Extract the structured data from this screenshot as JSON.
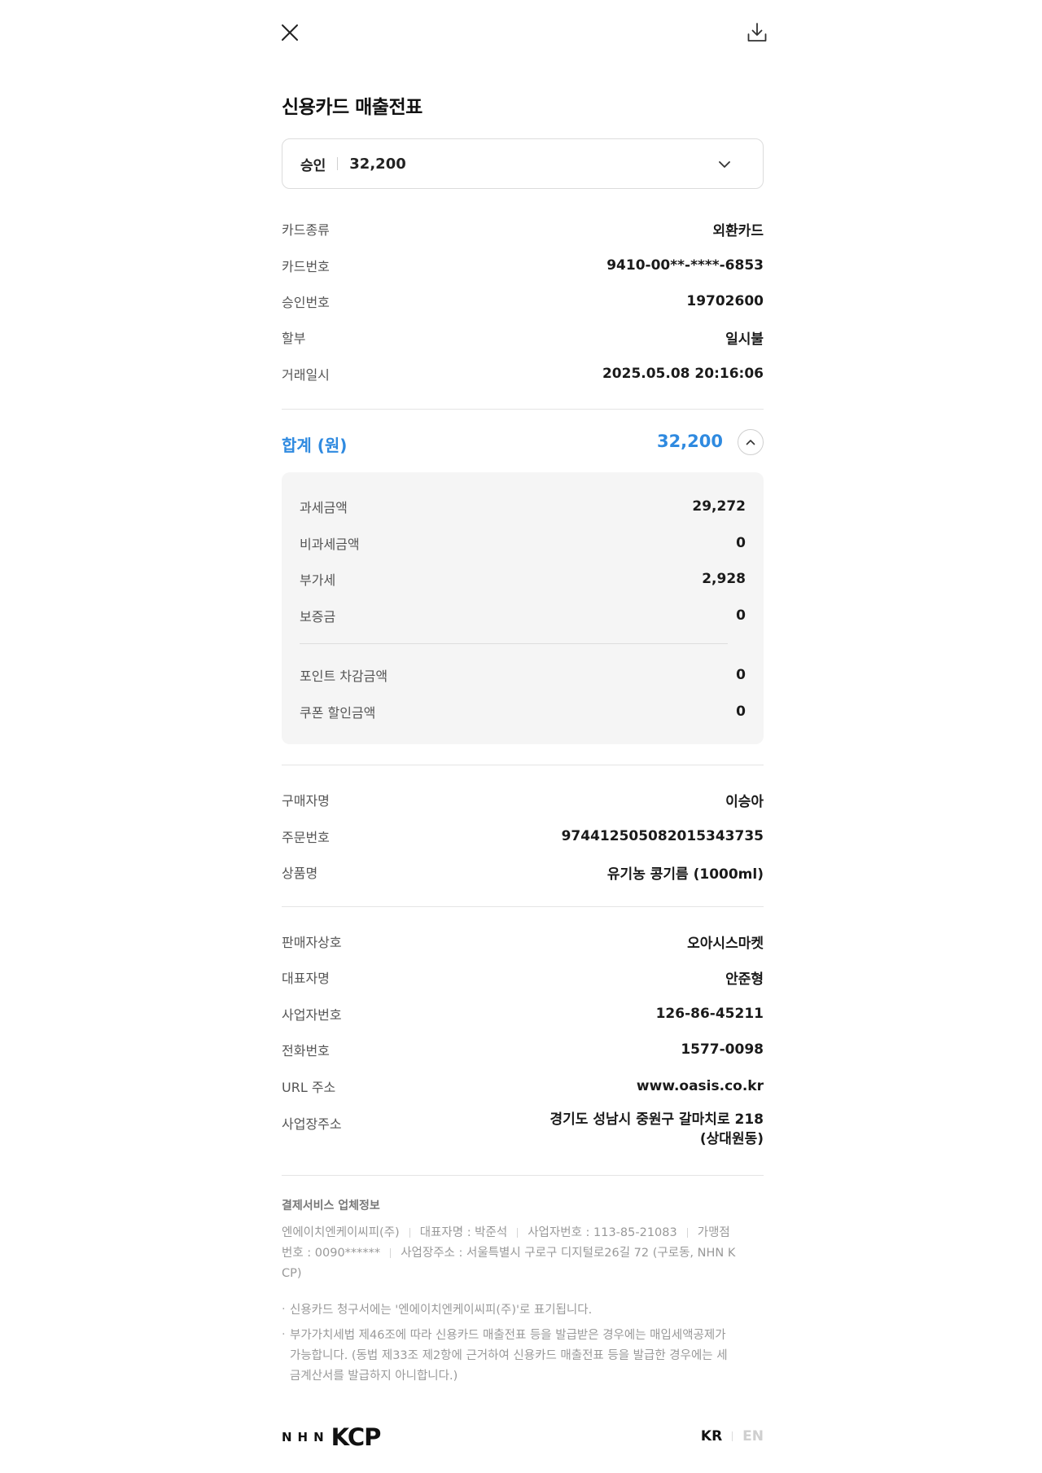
{
  "header": {
    "close_icon": "close-icon",
    "download_icon": "download-icon"
  },
  "title": "신용카드 매출전표",
  "status_select": {
    "status": "승인",
    "amount": "32,200"
  },
  "card_info": [
    {
      "label": "카드종류",
      "value": "외환카드"
    },
    {
      "label": "카드번호",
      "value": "9410-00**-****-6853"
    },
    {
      "label": "승인번호",
      "value": "19702600"
    },
    {
      "label": "할부",
      "value": "일시불"
    },
    {
      "label": "거래일시",
      "value": "2025.05.08 20:16:06"
    }
  ],
  "total": {
    "label": "합계 (원)",
    "value": "32,200"
  },
  "breakdown": [
    {
      "label": "과세금액",
      "value": "29,272"
    },
    {
      "label": "비과세금액",
      "value": "0"
    },
    {
      "label": "부가세",
      "value": "2,928"
    },
    {
      "label": "보증금",
      "value": "0"
    },
    {
      "label": "포인트 차감금액",
      "value": "0"
    },
    {
      "label": "쿠폰 할인금액",
      "value": "0"
    }
  ],
  "order_info": [
    {
      "label": "구매자명",
      "value": "이승아"
    },
    {
      "label": "주문번호",
      "value": "974412505082015343735"
    },
    {
      "label": "상품명",
      "value": "유기농 콩기름 (1000ml)"
    }
  ],
  "seller_info": [
    {
      "label": "판매자상호",
      "value": "오아시스마켓"
    },
    {
      "label": "대표자명",
      "value": "안준형"
    },
    {
      "label": "사업자번호",
      "value": "126-86-45211"
    },
    {
      "label": "전화번호",
      "value": "1577-0098"
    },
    {
      "label": "URL 주소",
      "value": "www.oasis.co.kr"
    },
    {
      "label": "사업장주소",
      "value_line1": "경기도 성남시 중원구 갈마치로 218",
      "value_line2": "(상대원동)"
    }
  ],
  "pg_info": {
    "title": "결제서비스 업체정보",
    "company": "엔에이치엔케이씨피(주)",
    "ceo": "대표자명 : 박준석",
    "biz_no": "사업자번호 : 113-85-21083",
    "merchant_no_label": "가맹점",
    "merchant_no": "번호 : 0090******",
    "address_line1": "사업장주소 : 서울특별시 구로구 디지털로26길 72 (구로동, NHN K",
    "address_line2": "CP)"
  },
  "notes": [
    {
      "line1": "신용카드 청구서에는 '엔에이치엔케이씨피(주)'로 표기됩니다."
    },
    {
      "line1": "부가가치세법 제46조에 따라 신용카드 매출전표 등을 발급받은 경우에는 매입세액공제가",
      "line2": "가능합니다. (동법 제33조 제2항에 근거하여 신용카드 매출전표 등을 발급한 경우에는 세",
      "line3": "금계산서를 발급하지 아니합니다.)"
    }
  ],
  "footer": {
    "logo_nhn": "NHN",
    "logo_kcp": "KCP",
    "lang_kr": "KR",
    "lang_en": "EN"
  },
  "colors": {
    "accent": "#2f8ae0",
    "label": "#555555",
    "muted": "#999999",
    "panel_bg": "#f5f5f5"
  }
}
